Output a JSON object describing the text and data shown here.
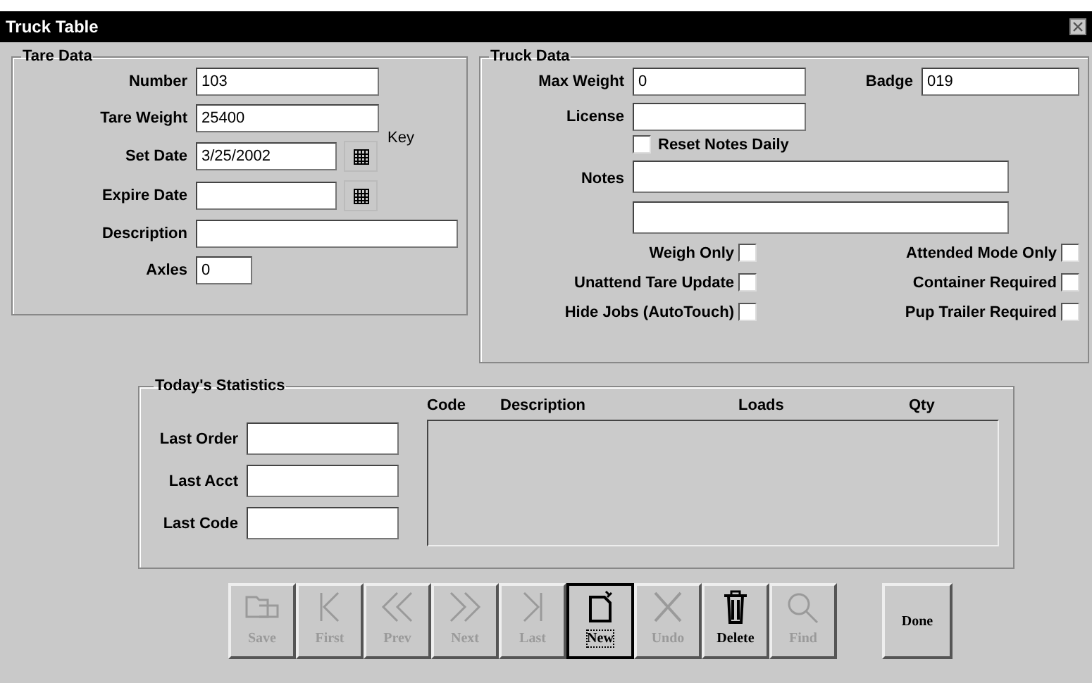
{
  "window": {
    "title": "Truck Table"
  },
  "tare_data": {
    "title": "Tare Data",
    "key_label": "Key",
    "fields": [
      {
        "label": "Number",
        "value": "103",
        "kind": "text"
      },
      {
        "label": "Tare Weight",
        "value": "25400",
        "kind": "text"
      },
      {
        "label": "Set Date",
        "value": "3/25/2002",
        "kind": "date"
      },
      {
        "label": "Expire Date",
        "kind": "date"
      },
      {
        "label": "Description",
        "kind": "wide"
      },
      {
        "label": "Axles",
        "value": "0",
        "kind": "short"
      }
    ]
  },
  "truck_data": {
    "title": "Truck Data",
    "max_weight": {
      "label": "Max Weight",
      "value": "0"
    },
    "badge": {
      "label": "Badge",
      "value": "019"
    },
    "license": {
      "label": "License"
    },
    "reset_notes": {
      "label": "Reset Notes Daily",
      "checked": false
    },
    "notes": {
      "label": "Notes"
    },
    "options": [
      {
        "label": "Weigh Only",
        "checked": false
      },
      {
        "label": "Attended Mode Only",
        "checked": false
      },
      {
        "label": "Unattend Tare Update",
        "checked": false
      },
      {
        "label": "Container Required",
        "checked": false
      },
      {
        "label": "Hide Jobs (AutoTouch)",
        "checked": false
      },
      {
        "label": "Pup Trailer Required",
        "checked": false
      }
    ]
  },
  "statistics": {
    "title": "Today's Statistics",
    "fields": [
      {
        "label": "Last Order"
      },
      {
        "label": "Last Acct"
      },
      {
        "label": "Last Code"
      }
    ],
    "columns": [
      "Code",
      "Description",
      "Loads",
      "Qty"
    ]
  },
  "toolbar": [
    {
      "label": "Save",
      "kind": "save",
      "disabled": true,
      "focused": false
    },
    {
      "label": "First",
      "kind": "first",
      "disabled": true,
      "focused": false
    },
    {
      "label": "Prev",
      "kind": "prev",
      "disabled": true,
      "focused": false
    },
    {
      "label": "Next",
      "kind": "next",
      "disabled": true,
      "focused": false
    },
    {
      "label": "Last",
      "kind": "last",
      "disabled": true,
      "focused": false
    },
    {
      "label": "New",
      "kind": "new",
      "disabled": false,
      "focused": true
    },
    {
      "label": "Undo",
      "kind": "undo",
      "disabled": true,
      "focused": false
    },
    {
      "label": "Delete",
      "kind": "delete",
      "disabled": false,
      "focused": false
    },
    {
      "label": "Find",
      "kind": "find",
      "disabled": true,
      "focused": false
    }
  ],
  "done_button": {
    "label": "Done"
  }
}
